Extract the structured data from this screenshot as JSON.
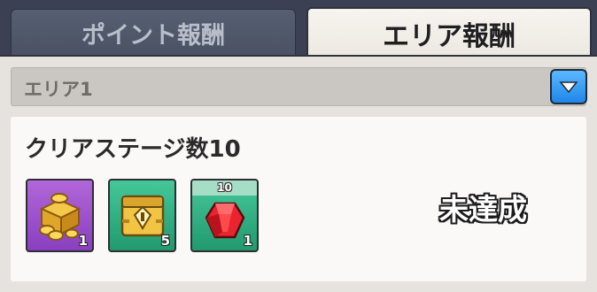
{
  "tabs": [
    {
      "label": "ポイント報酬",
      "active": false
    },
    {
      "label": "エリア報酬",
      "active": true
    }
  ],
  "dropdown": {
    "selected": "エリア1",
    "icon": "chevron-down-icon"
  },
  "card": {
    "title": "クリアステージ数10",
    "rewards": [
      {
        "icon": "gold-coin-crate-icon",
        "count": "1",
        "color": "#9c4fcc"
      },
      {
        "icon": "treasure-chest-icon",
        "count": "5",
        "color": "#2fb182"
      },
      {
        "icon": "red-gem-icon",
        "count": "1",
        "top_label": "10",
        "color": "#2fb182"
      }
    ],
    "status": "未達成"
  },
  "colors": {
    "accent": "#2f93f0",
    "panel": "#e6e3de",
    "card": "#fbf9f7"
  }
}
